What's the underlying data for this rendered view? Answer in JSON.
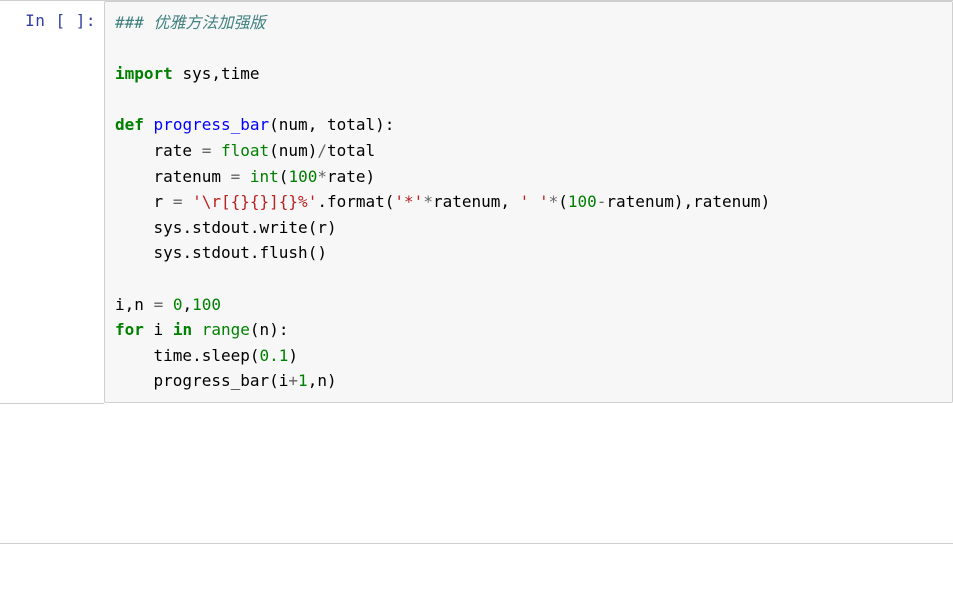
{
  "prompt": {
    "in_label": "In [ ]:"
  },
  "code": {
    "comment": "### 优雅方法加强版",
    "kw_import": "import",
    "mod_sys": "sys",
    "comma1": ",",
    "mod_time": "time",
    "kw_def": "def",
    "fn_progress_bar": "progress_bar",
    "sig_open": "(",
    "arg_num": "num",
    "sig_comma": ",",
    "arg_total": "total",
    "sig_close": ")",
    "sig_colon": ":",
    "l3_rate": "rate",
    "l3_eq": "=",
    "l3_float": "float",
    "l3_open": "(",
    "l3_numarg": "num",
    "l3_close": ")",
    "l3_div": "/",
    "l3_total": "total",
    "l4_ratenum": "ratenum",
    "l4_eq": "=",
    "l4_int": "int",
    "l4_open": "(",
    "l4_100": "100",
    "l4_mul": "*",
    "l4_rate": "rate",
    "l4_close": ")",
    "l5_r": "r",
    "l5_eq": "=",
    "l5_str": "'\\r[{}{}]{}%'",
    "l5_dot": ".",
    "l5_format": "format",
    "l5_open": "(",
    "l5_s1": "'*'",
    "l5_mul1": "*",
    "l5_ratenum1": "ratenum",
    "l5_comma1": ",",
    "l5_s2": "' '",
    "l5_mul2": "*",
    "l5_sub_open": "(",
    "l5_100": "100",
    "l5_minus": "-",
    "l5_ratenum2": "ratenum",
    "l5_sub_close": ")",
    "l5_comma2": ",",
    "l5_ratenum3": "ratenum",
    "l5_close": ")",
    "l6_sys": "sys",
    "l6_dot1": ".",
    "l6_stdout": "stdout",
    "l6_dot2": ".",
    "l6_write": "write",
    "l6_open": "(",
    "l6_r": "r",
    "l6_close": ")",
    "l7_sys": "sys",
    "l7_dot1": ".",
    "l7_stdout": "stdout",
    "l7_dot2": ".",
    "l7_flush": "flush",
    "l7_open": "(",
    "l7_close": ")",
    "l8_i": "i",
    "l8_comma": ",",
    "l8_n": "n",
    "l8_eq": "=",
    "l8_0": "0",
    "l8_comma2": ",",
    "l8_100": "100",
    "l9_for": "for",
    "l9_i": "i",
    "l9_in": "in",
    "l9_range": "range",
    "l9_open": "(",
    "l9_n": "n",
    "l9_close": ")",
    "l9_colon": ":",
    "l10_time": "time",
    "l10_dot": ".",
    "l10_sleep": "sleep",
    "l10_open": "(",
    "l10_val": "0.1",
    "l10_close": ")",
    "l11_pb": "progress_bar",
    "l11_open": "(",
    "l11_i": "i",
    "l11_plus": "+",
    "l11_1": "1",
    "l11_comma": ",",
    "l11_n": "n",
    "l11_close": ")"
  }
}
